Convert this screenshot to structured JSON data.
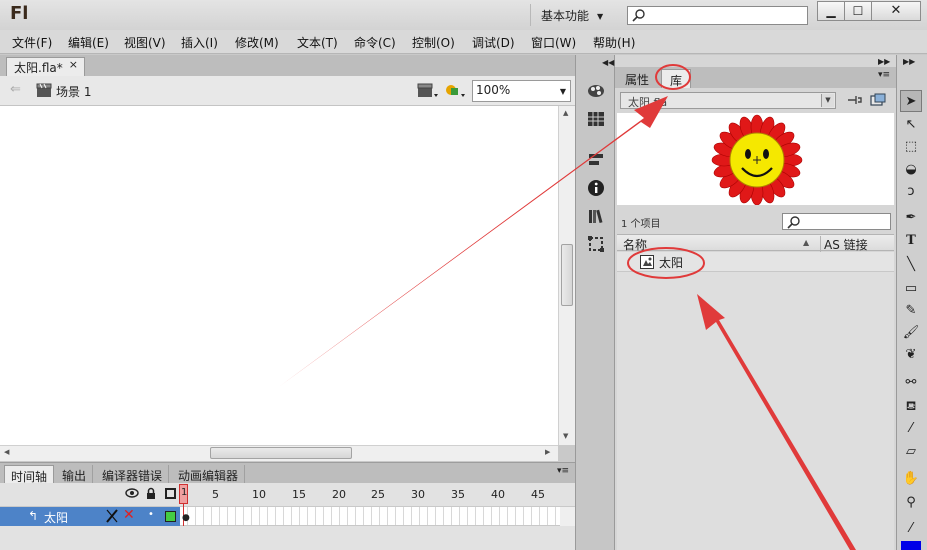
{
  "app": {
    "logo": "Fl",
    "workspace_label": "基本功能",
    "search_placeholder": "",
    "window_buttons": {
      "minimize": "▁",
      "maximize": "☐",
      "close": "✕"
    }
  },
  "menu": [
    "文件(F)",
    "编辑(E)",
    "视图(V)",
    "插入(I)",
    "修改(M)",
    "文本(T)",
    "命令(C)",
    "控制(O)",
    "调试(D)",
    "窗口(W)",
    "帮助(H)"
  ],
  "document": {
    "tab_title": "太阳.fla*",
    "tab_close": "×",
    "scene_label": "场景 1",
    "zoom": "100%"
  },
  "timeline": {
    "tabs": [
      "时间轴",
      "输出",
      "编译器错误",
      "动画编辑器"
    ],
    "frame_numbers": [
      "1",
      "5",
      "10",
      "15",
      "20",
      "25",
      "30",
      "35",
      "40",
      "45"
    ],
    "layer": {
      "name": "太阳",
      "color": "#44cc44"
    }
  },
  "library": {
    "tabs": [
      "属性",
      "库"
    ],
    "active_tab": "库",
    "document_select": "太阳.fla",
    "item_count": "1 个项目",
    "columns": {
      "name": "名称",
      "linkage": "AS 链接"
    },
    "items": [
      {
        "name": "太阳",
        "icon": "graphic-symbol-icon"
      }
    ]
  },
  "dock_icons": [
    "color-swatch-icon",
    "grid-swatches-icon",
    "align-icon",
    "info-icon",
    "library-books-icon",
    "transform-icon"
  ],
  "tools": [
    "selection-tool-icon",
    "subselection-tool-icon",
    "free-transform-tool-icon",
    "3d-rotation-tool-icon",
    "lasso-tool-icon",
    "pen-tool-icon",
    "text-tool-icon",
    "line-tool-icon",
    "rectangle-tool-icon",
    "pencil-tool-icon",
    "brush-tool-icon",
    "deco-tool-icon",
    "bone-tool-icon",
    "paint-bucket-tool-icon",
    "eyedropper-tool-icon",
    "eraser-tool-icon",
    "hand-tool-icon",
    "zoom-tool-icon",
    "stroke-color-icon"
  ],
  "colors": {
    "annotation": "#e03a3a",
    "fill_swatch": "#0000e8",
    "layer_highlight": "#4d83c8"
  }
}
